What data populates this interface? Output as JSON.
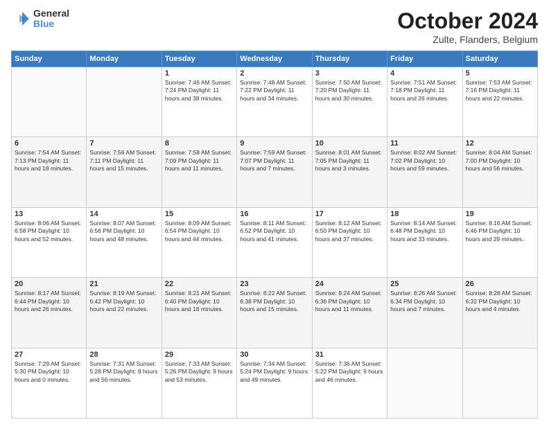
{
  "header": {
    "logo_line1": "General",
    "logo_line2": "Blue",
    "title": "October 2024",
    "subtitle": "Zulte, Flanders, Belgium"
  },
  "weekdays": [
    "Sunday",
    "Monday",
    "Tuesday",
    "Wednesday",
    "Thursday",
    "Friday",
    "Saturday"
  ],
  "weeks": [
    [
      {
        "day": "",
        "detail": ""
      },
      {
        "day": "",
        "detail": ""
      },
      {
        "day": "1",
        "detail": "Sunrise: 7:46 AM\nSunset: 7:24 PM\nDaylight: 11 hours and 38 minutes."
      },
      {
        "day": "2",
        "detail": "Sunrise: 7:48 AM\nSunset: 7:22 PM\nDaylight: 11 hours and 34 minutes."
      },
      {
        "day": "3",
        "detail": "Sunrise: 7:50 AM\nSunset: 7:20 PM\nDaylight: 11 hours and 30 minutes."
      },
      {
        "day": "4",
        "detail": "Sunrise: 7:51 AM\nSunset: 7:18 PM\nDaylight: 11 hours and 26 minutes."
      },
      {
        "day": "5",
        "detail": "Sunrise: 7:53 AM\nSunset: 7:16 PM\nDaylight: 11 hours and 22 minutes."
      }
    ],
    [
      {
        "day": "6",
        "detail": "Sunrise: 7:54 AM\nSunset: 7:13 PM\nDaylight: 11 hours and 18 minutes."
      },
      {
        "day": "7",
        "detail": "Sunrise: 7:56 AM\nSunset: 7:11 PM\nDaylight: 11 hours and 15 minutes."
      },
      {
        "day": "8",
        "detail": "Sunrise: 7:58 AM\nSunset: 7:09 PM\nDaylight: 11 hours and 11 minutes."
      },
      {
        "day": "9",
        "detail": "Sunrise: 7:59 AM\nSunset: 7:07 PM\nDaylight: 11 hours and 7 minutes."
      },
      {
        "day": "10",
        "detail": "Sunrise: 8:01 AM\nSunset: 7:05 PM\nDaylight: 11 hours and 3 minutes."
      },
      {
        "day": "11",
        "detail": "Sunrise: 8:02 AM\nSunset: 7:02 PM\nDaylight: 10 hours and 59 minutes."
      },
      {
        "day": "12",
        "detail": "Sunrise: 8:04 AM\nSunset: 7:00 PM\nDaylight: 10 hours and 56 minutes."
      }
    ],
    [
      {
        "day": "13",
        "detail": "Sunrise: 8:06 AM\nSunset: 6:58 PM\nDaylight: 10 hours and 52 minutes."
      },
      {
        "day": "14",
        "detail": "Sunrise: 8:07 AM\nSunset: 6:56 PM\nDaylight: 10 hours and 48 minutes."
      },
      {
        "day": "15",
        "detail": "Sunrise: 8:09 AM\nSunset: 6:54 PM\nDaylight: 10 hours and 44 minutes."
      },
      {
        "day": "16",
        "detail": "Sunrise: 8:11 AM\nSunset: 6:52 PM\nDaylight: 10 hours and 41 minutes."
      },
      {
        "day": "17",
        "detail": "Sunrise: 8:12 AM\nSunset: 6:50 PM\nDaylight: 10 hours and 37 minutes."
      },
      {
        "day": "18",
        "detail": "Sunrise: 8:14 AM\nSunset: 6:48 PM\nDaylight: 10 hours and 33 minutes."
      },
      {
        "day": "19",
        "detail": "Sunrise: 8:16 AM\nSunset: 6:46 PM\nDaylight: 10 hours and 29 minutes."
      }
    ],
    [
      {
        "day": "20",
        "detail": "Sunrise: 8:17 AM\nSunset: 6:44 PM\nDaylight: 10 hours and 26 minutes."
      },
      {
        "day": "21",
        "detail": "Sunrise: 8:19 AM\nSunset: 6:42 PM\nDaylight: 10 hours and 22 minutes."
      },
      {
        "day": "22",
        "detail": "Sunrise: 8:21 AM\nSunset: 6:40 PM\nDaylight: 10 hours and 18 minutes."
      },
      {
        "day": "23",
        "detail": "Sunrise: 8:22 AM\nSunset: 6:38 PM\nDaylight: 10 hours and 15 minutes."
      },
      {
        "day": "24",
        "detail": "Sunrise: 8:24 AM\nSunset: 6:36 PM\nDaylight: 10 hours and 11 minutes."
      },
      {
        "day": "25",
        "detail": "Sunrise: 8:26 AM\nSunset: 6:34 PM\nDaylight: 10 hours and 7 minutes."
      },
      {
        "day": "26",
        "detail": "Sunrise: 8:28 AM\nSunset: 6:32 PM\nDaylight: 10 hours and 4 minutes."
      }
    ],
    [
      {
        "day": "27",
        "detail": "Sunrise: 7:29 AM\nSunset: 5:30 PM\nDaylight: 10 hours and 0 minutes."
      },
      {
        "day": "28",
        "detail": "Sunrise: 7:31 AM\nSunset: 5:28 PM\nDaylight: 9 hours and 56 minutes."
      },
      {
        "day": "29",
        "detail": "Sunrise: 7:33 AM\nSunset: 5:26 PM\nDaylight: 9 hours and 53 minutes."
      },
      {
        "day": "30",
        "detail": "Sunrise: 7:34 AM\nSunset: 5:24 PM\nDaylight: 9 hours and 49 minutes."
      },
      {
        "day": "31",
        "detail": "Sunrise: 7:36 AM\nSunset: 5:22 PM\nDaylight: 9 hours and 46 minutes."
      },
      {
        "day": "",
        "detail": ""
      },
      {
        "day": "",
        "detail": ""
      }
    ]
  ]
}
